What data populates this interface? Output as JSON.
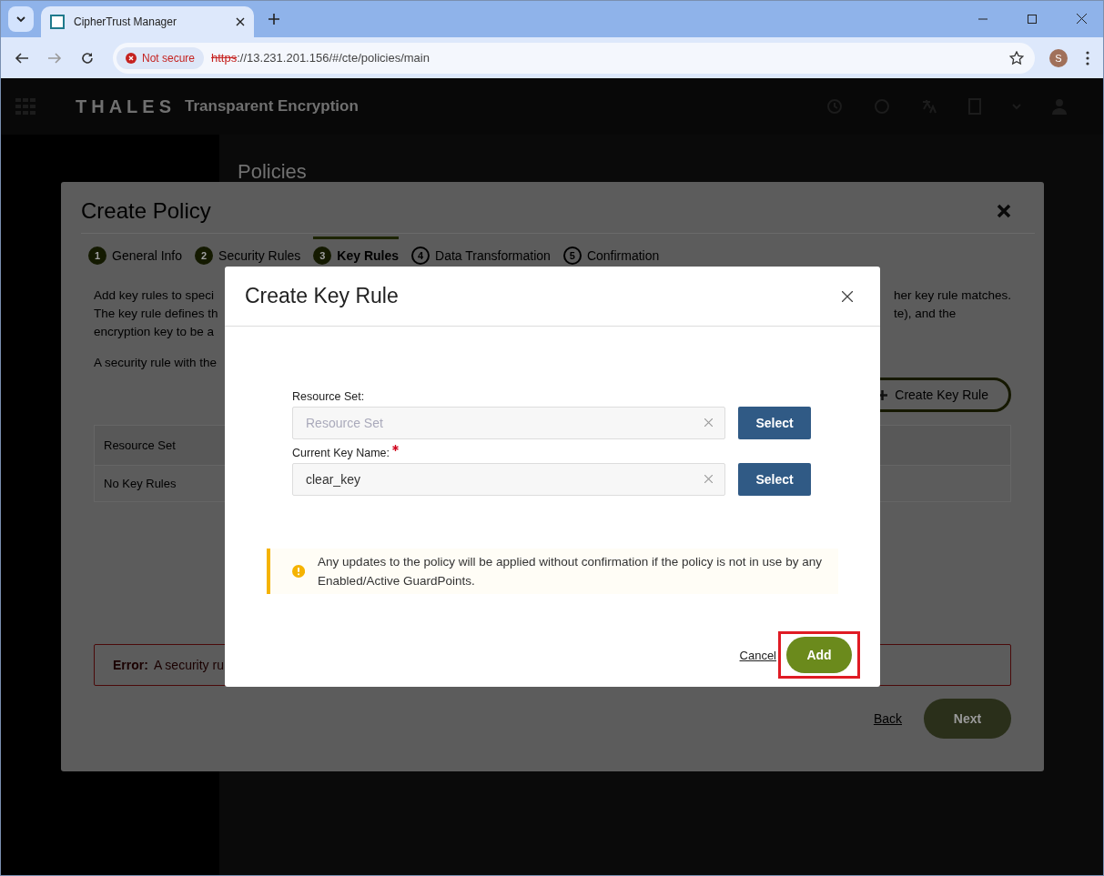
{
  "browser": {
    "tab_title": "CipherTrust Manager",
    "security_chip": "Not secure",
    "url_scheme": "https",
    "url_rest": "://13.231.201.156/#/cte/policies/main",
    "profile_initial": "S"
  },
  "app_header": {
    "logo": "THALES",
    "product": "Transparent Encryption"
  },
  "page": {
    "heading": "Policies"
  },
  "policy_dialog": {
    "title": "Create Policy",
    "steps": [
      {
        "number": "1",
        "label": "General Info",
        "completed": true,
        "selected": false
      },
      {
        "number": "2",
        "label": "Security Rules",
        "completed": true,
        "selected": false
      },
      {
        "number": "3",
        "label": "Key Rules",
        "completed": false,
        "selected": true
      },
      {
        "number": "4",
        "label": "Data Transformation",
        "completed": false,
        "selected": false
      },
      {
        "number": "5",
        "label": "Confirmation",
        "completed": false,
        "selected": false
      }
    ],
    "intro_left": [
      "Add key rules to speci",
      "The key rule defines th",
      "encryption key to be a"
    ],
    "intro_right": [
      "her key rule matches.",
      "te), and the"
    ],
    "note_left": "A security rule with the",
    "create_button": "Create Key Rule",
    "table": {
      "column_1": "Resource Set",
      "empty_text": "No Key Rules"
    },
    "error_label": "Error:",
    "error_text": "A security ru",
    "back_link": "Back",
    "next_button": "Next"
  },
  "key_rule_modal": {
    "title": "Create Key Rule",
    "fields": [
      {
        "label": "Resource Set:",
        "required": false,
        "placeholder": "Resource Set",
        "button": "Select"
      },
      {
        "label": "Current Key Name:",
        "required": true,
        "value": "clear_key",
        "button": "Select"
      }
    ],
    "warning": "Any updates to the policy will be applied without confirmation if the policy is not in use by any Enabled/Active GuardPoints.",
    "cancel_link": "Cancel",
    "add_button": {
      "label": "Add",
      "highlighted": true
    }
  }
}
